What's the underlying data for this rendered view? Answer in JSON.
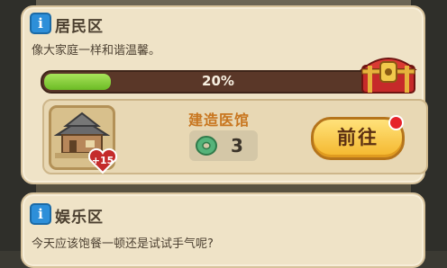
{
  "residential": {
    "title": "居民区",
    "subtitle": "像大家庭一样和谐温馨。",
    "progress_text": "20%",
    "progress_value": 0.2
  },
  "task": {
    "label": "建造医馆",
    "cost": "3",
    "reward_badge": "+15",
    "go_button": "前往"
  },
  "entertainment": {
    "title": "娱乐区",
    "subtitle": "今天应该饱餐一顿还是试试手气呢?"
  },
  "icons": {
    "info": "i",
    "chest": "treasure-chest-icon",
    "gem": "jade-coin-icon",
    "heart": "heart-icon"
  },
  "colors": {
    "progress_fill": "#7bc92f",
    "button": "#f4b62c",
    "title_orange": "#c8761f"
  }
}
